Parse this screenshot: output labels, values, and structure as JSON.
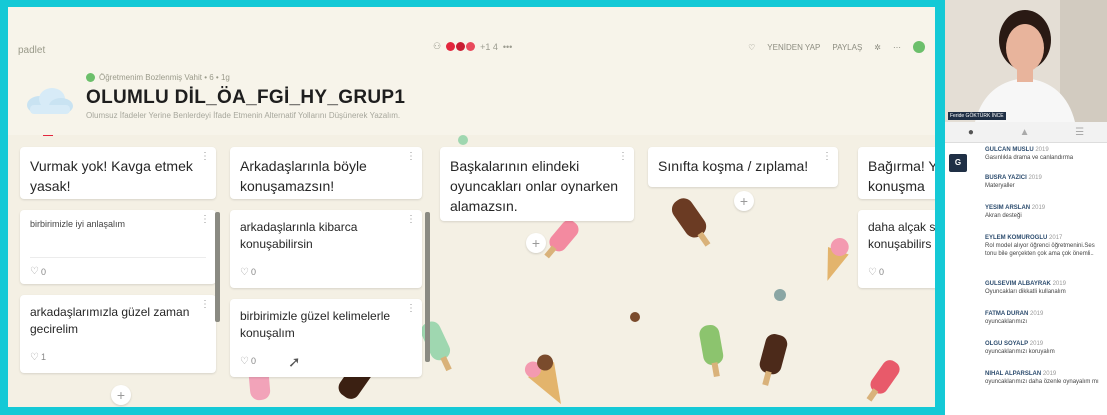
{
  "app": {
    "brand": "padlet",
    "members_text": "+1 4",
    "top_actions": [
      "YENİDEN YAP",
      "PAYLAŞ"
    ]
  },
  "wall": {
    "author_line": "Öğretmenim Bozlenmiş Vahit  •  6  •  1g",
    "title": "OLUMLU DİL_ÖA_FGİ_HY_GRUP1",
    "subtitle": "Olumsuz İfadeler Yerine Benlerdeyi İfade Etmenin Alternatif Yollarını Düşünerek Yazalım."
  },
  "columns": [
    {
      "heading": "Vurmak yok! Kavga etmek yasak!",
      "cards": [
        {
          "text": "birbirimizle iyi anlaşalım",
          "likes": "0"
        },
        {
          "text": "arkadaşlarımızla güzel zaman gecirelim",
          "likes": "1"
        }
      ]
    },
    {
      "heading": "Arkadaşlarınla böyle konuşamazsın!",
      "cards": [
        {
          "text": "arkadaşlarınla kibarca konuşabilirsin",
          "likes": "0"
        },
        {
          "text": "birbirimizle güzel kelimelerle konuşalım",
          "likes": "0"
        }
      ]
    },
    {
      "heading": "Başkalarının elindeki oyuncakları onlar oynarken alamazsın.",
      "cards": []
    },
    {
      "heading": "Sınıfta koşma / zıplama!",
      "cards": []
    },
    {
      "heading": "Bağırma! Y konuşma",
      "cards": [
        {
          "text": "daha alçak s konuşabilirs",
          "likes": "0"
        }
      ]
    }
  ],
  "webcam": {
    "name_label": "Feride GÖKTÜRK İNCE"
  },
  "side_badge": "G",
  "comments": [
    {
      "name": "GULCAN MUSLU",
      "year": "2019",
      "text": "Gasınlıkla drama ve canlandırma"
    },
    {
      "name": "BUSRA YAZICI",
      "year": "2019",
      "text": "Materyaller"
    },
    {
      "name": "YESIM ARSLAN",
      "year": "2019",
      "text": "Akran desteği"
    },
    {
      "name": "EYLEM KOMUROGLU",
      "year": "2017",
      "text": "Rol model alıyor öğrenci öğretmenini.Ses tonu bile gerçekten çok ama çok önemli.."
    },
    {
      "name": "GULSEVIM ALBAYRAK",
      "year": "2019",
      "text": "Oyuncakları dikkatli kullanalım"
    },
    {
      "name": "FATMA DURAN",
      "year": "2019",
      "text": "oyuncaklarımızı"
    },
    {
      "name": "OLGU SOYALP",
      "year": "2019",
      "text": "oyuncaklarımızı koruyalım"
    },
    {
      "name": "NIHAL ALPARSLAN",
      "year": "2019",
      "text": "oyuncaklarımızı daha özenle oynayalım mı"
    }
  ],
  "colors": {
    "frame": "#14c9d6",
    "background": "#f4f0e4",
    "accent_red": "#e3263d"
  }
}
